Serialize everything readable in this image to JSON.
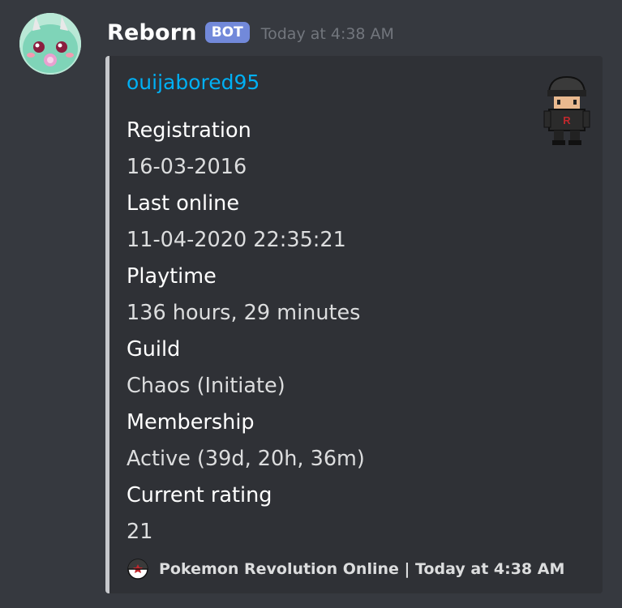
{
  "message": {
    "author": "Reborn",
    "badge": "BOT",
    "timestamp": "Today at 4:38 AM"
  },
  "embed": {
    "author_name": "ouijabored95",
    "fields": [
      {
        "name": "Registration",
        "value": "16-03-2016"
      },
      {
        "name": "Last online",
        "value": "11-04-2020 22:35:21"
      },
      {
        "name": "Playtime",
        "value": "136 hours, 29 minutes"
      },
      {
        "name": "Guild",
        "value": "Chaos (Initiate)"
      },
      {
        "name": "Membership",
        "value": "Active (39d, 20h, 36m)"
      },
      {
        "name": "Current rating",
        "value": "21"
      }
    ],
    "footer": "Pokemon Revolution Online | Today at 4:38 AM",
    "accent_color": "#c6c8cc",
    "thumbnail_icon": "trainer-sprite-icon",
    "footer_icon": "pokeball-logo-icon"
  },
  "colors": {
    "background": "#36393f",
    "embed_background": "#2f3136",
    "link": "#00b0f4",
    "bot_badge": "#7289da"
  }
}
